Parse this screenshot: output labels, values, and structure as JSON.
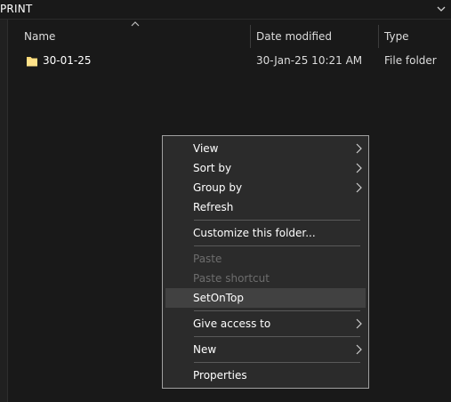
{
  "address": {
    "text": "PRINT"
  },
  "columns": {
    "name": "Name",
    "date": "Date modified",
    "type": "Type"
  },
  "rows": [
    {
      "name": "30-01-25",
      "date": "30-Jan-25 10:21 AM",
      "type": "File folder",
      "icon": "folder-icon"
    }
  ],
  "menu": {
    "view": "View",
    "sort_by": "Sort by",
    "group_by": "Group by",
    "refresh": "Refresh",
    "customize": "Customize this folder...",
    "paste": "Paste",
    "paste_shortcut": "Paste shortcut",
    "setontop": "SetOnTop",
    "give_access": "Give access to",
    "new": "New",
    "properties": "Properties"
  },
  "colors": {
    "folder": "#f8d775",
    "menu_bg": "#2b2b2b",
    "highlight": "#414141",
    "disabled": "#6d6d6d"
  }
}
